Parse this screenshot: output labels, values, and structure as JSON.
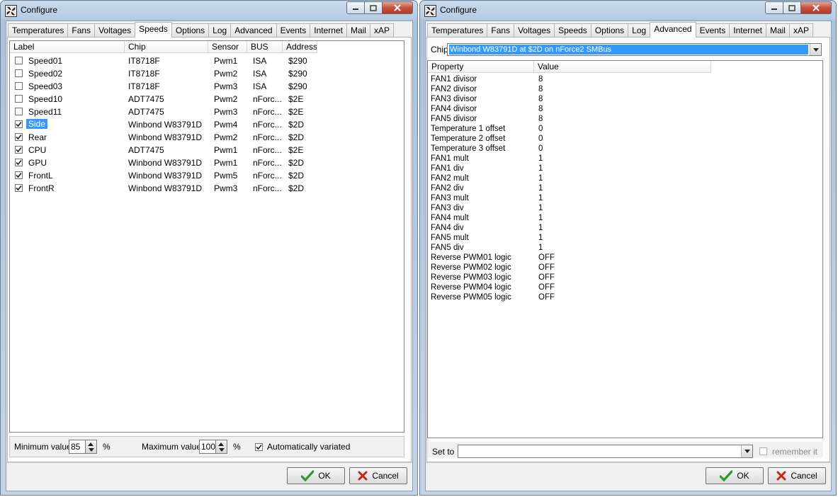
{
  "left_window": {
    "title": "Configure",
    "tabs": [
      "Temperatures",
      "Fans",
      "Voltages",
      "Speeds",
      "Options",
      "Log",
      "Advanced",
      "Events",
      "Internet",
      "Mail",
      "xAP"
    ],
    "active_tab": "Speeds",
    "columns": [
      "Label",
      "Chip",
      "Sensor",
      "BUS",
      "Address"
    ],
    "rows": [
      {
        "checked": false,
        "label": "Speed01",
        "chip": "IT8718F",
        "sensor": "Pwm1",
        "bus": "ISA",
        "address": "$290"
      },
      {
        "checked": false,
        "label": "Speed02",
        "chip": "IT8718F",
        "sensor": "Pwm2",
        "bus": "ISA",
        "address": "$290"
      },
      {
        "checked": false,
        "label": "Speed03",
        "chip": "IT8718F",
        "sensor": "Pwm3",
        "bus": "ISA",
        "address": "$290"
      },
      {
        "checked": false,
        "label": "Speed10",
        "chip": "ADT7475",
        "sensor": "Pwm2",
        "bus": "nForc...",
        "address": "$2E"
      },
      {
        "checked": false,
        "label": "Speed11",
        "chip": "ADT7475",
        "sensor": "Pwm3",
        "bus": "nForc...",
        "address": "$2E"
      },
      {
        "checked": true,
        "label": "Side",
        "chip": "Winbond W83791D",
        "sensor": "Pwm4",
        "bus": "nForc...",
        "address": "$2D",
        "selected": true
      },
      {
        "checked": true,
        "label": "Rear",
        "chip": "Winbond W83791D",
        "sensor": "Pwm2",
        "bus": "nForc...",
        "address": "$2D"
      },
      {
        "checked": true,
        "label": "CPU",
        "chip": "ADT7475",
        "sensor": "Pwm1",
        "bus": "nForc...",
        "address": "$2E"
      },
      {
        "checked": true,
        "label": "GPU",
        "chip": "Winbond W83791D",
        "sensor": "Pwm1",
        "bus": "nForc...",
        "address": "$2D"
      },
      {
        "checked": true,
        "label": "FrontL",
        "chip": "Winbond W83791D",
        "sensor": "Pwm5",
        "bus": "nForc...",
        "address": "$2D"
      },
      {
        "checked": true,
        "label": "FrontR",
        "chip": "Winbond W83791D",
        "sensor": "Pwm3",
        "bus": "nForc...",
        "address": "$2D"
      }
    ],
    "min_label": "Minimum value",
    "min_value": "85",
    "max_label": "Maximum value",
    "max_value": "100",
    "percent": "%",
    "auto_label": "Automatically variated",
    "auto_checked": true,
    "ok_label": "OK",
    "cancel_label": "Cancel"
  },
  "right_window": {
    "title": "Configure",
    "tabs": [
      "Temperatures",
      "Fans",
      "Voltages",
      "Speeds",
      "Options",
      "Log",
      "Advanced",
      "Events",
      "Internet",
      "Mail",
      "xAP"
    ],
    "active_tab": "Advanced",
    "chip_label": "Chip",
    "chip_value": "Winbond W83791D at $2D on nForce2 SMBus",
    "columns": [
      "Property",
      "Value"
    ],
    "properties": [
      {
        "name": "FAN1 divisor",
        "value": "8"
      },
      {
        "name": "FAN2 divisor",
        "value": "8"
      },
      {
        "name": "FAN3 divisor",
        "value": "8"
      },
      {
        "name": "FAN4 divisor",
        "value": "8"
      },
      {
        "name": "FAN5 divisor",
        "value": "8"
      },
      {
        "name": "Temperature 1 offset",
        "value": "0"
      },
      {
        "name": "Temperature 2 offset",
        "value": "0"
      },
      {
        "name": "Temperature 3 offset",
        "value": "0"
      },
      {
        "name": "FAN1 mult",
        "value": "1"
      },
      {
        "name": "FAN1 div",
        "value": "1"
      },
      {
        "name": "FAN2 mult",
        "value": "1"
      },
      {
        "name": "FAN2 div",
        "value": "1"
      },
      {
        "name": "FAN3 mult",
        "value": "1"
      },
      {
        "name": "FAN3 div",
        "value": "1"
      },
      {
        "name": "FAN4 mult",
        "value": "1"
      },
      {
        "name": "FAN4 div",
        "value": "1"
      },
      {
        "name": "FAN5 mult",
        "value": "1"
      },
      {
        "name": "FAN5 div",
        "value": "1"
      },
      {
        "name": "Reverse PWM01 logic",
        "value": "OFF"
      },
      {
        "name": "Reverse PWM02 logic",
        "value": "OFF"
      },
      {
        "name": "Reverse PWM03 logic",
        "value": "OFF"
      },
      {
        "name": "Reverse PWM04 logic",
        "value": "OFF"
      },
      {
        "name": "Reverse PWM05 logic",
        "value": "OFF"
      }
    ],
    "set_to_label": "Set to",
    "set_to_value": "",
    "remember_label": "remember it",
    "remember_checked": false,
    "ok_label": "OK",
    "cancel_label": "Cancel"
  },
  "colors": {
    "selection": "#3399ff",
    "ok_check": "#2a9d2a",
    "cancel_x": "#c8241c"
  }
}
